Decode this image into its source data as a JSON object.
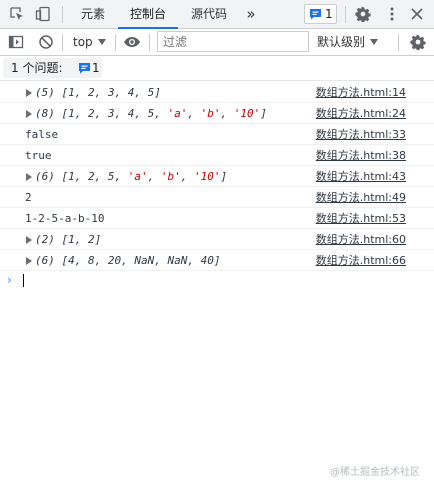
{
  "topbar": {
    "tabs": [
      {
        "label": "元素",
        "active": false
      },
      {
        "label": "控制台",
        "active": true
      },
      {
        "label": "源代码",
        "active": false
      }
    ],
    "more_label": "»",
    "issues_badge_count": "1",
    "icons": [
      "inspect-icon",
      "device-toggle-icon",
      "gear-icon",
      "kebab-menu-icon",
      "close-icon"
    ]
  },
  "toolbar": {
    "context": "top",
    "filter_placeholder": "过滤",
    "level": "默认级别"
  },
  "issues_bar": {
    "label": "1 个问题:",
    "count": "1"
  },
  "console": {
    "rows": [
      {
        "expandable": true,
        "prefix": "(5) ",
        "tokens": [
          {
            "t": "[",
            "c": ""
          },
          {
            "t": "1",
            "c": ""
          },
          {
            "t": ", ",
            "c": ""
          },
          {
            "t": "2",
            "c": ""
          },
          {
            "t": ", ",
            "c": ""
          },
          {
            "t": "3",
            "c": ""
          },
          {
            "t": ", ",
            "c": ""
          },
          {
            "t": "4",
            "c": ""
          },
          {
            "t": ", ",
            "c": ""
          },
          {
            "t": "5",
            "c": ""
          },
          {
            "t": "]",
            "c": ""
          }
        ],
        "source": "数组方法.html:14"
      },
      {
        "expandable": true,
        "prefix": "(8) ",
        "tokens": [
          {
            "t": "[1, 2, 3, 4, 5, ",
            "c": ""
          },
          {
            "t": "'a'",
            "c": "str"
          },
          {
            "t": ", ",
            "c": ""
          },
          {
            "t": "'b'",
            "c": "str"
          },
          {
            "t": ", ",
            "c": ""
          },
          {
            "t": "'10'",
            "c": "str"
          },
          {
            "t": "]",
            "c": ""
          }
        ],
        "source": "数组方法.html:24"
      },
      {
        "expandable": false,
        "text": "false",
        "source": "数组方法.html:33"
      },
      {
        "expandable": false,
        "text": "true",
        "source": "数组方法.html:38"
      },
      {
        "expandable": true,
        "prefix": "(6) ",
        "tokens": [
          {
            "t": "[1, 2, 5, ",
            "c": ""
          },
          {
            "t": "'a'",
            "c": "str"
          },
          {
            "t": ", ",
            "c": ""
          },
          {
            "t": "'b'",
            "c": "str"
          },
          {
            "t": ", ",
            "c": ""
          },
          {
            "t": "'10'",
            "c": "str"
          },
          {
            "t": "]",
            "c": ""
          }
        ],
        "source": "数组方法.html:43"
      },
      {
        "expandable": false,
        "text": "2",
        "source": "数组方法.html:49"
      },
      {
        "expandable": false,
        "text": "1-2-5-a-b-10",
        "source": "数组方法.html:53"
      },
      {
        "expandable": true,
        "prefix": "(2) ",
        "tokens": [
          {
            "t": "[1, 2]",
            "c": ""
          }
        ],
        "source": "数组方法.html:60"
      },
      {
        "expandable": true,
        "prefix": "(6) ",
        "tokens": [
          {
            "t": "[4, 8, 20, NaN, NaN, 40]",
            "c": ""
          }
        ],
        "source": "数组方法.html:66"
      }
    ],
    "prompt_symbol": "›"
  },
  "watermark": "@稀土掘金技术社区",
  "colors": {
    "accent": "#1a73e8",
    "string": "#c80000",
    "badge": "#1a73e8"
  }
}
